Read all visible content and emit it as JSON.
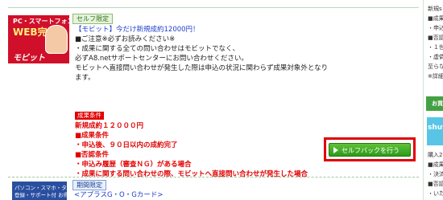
{
  "offer": {
    "thumbnail": {
      "line1": "PC・スマートフォンから",
      "line2": "WEB完結",
      "brand": "モビット"
    },
    "badge": "セルフ限定",
    "title": "【モビット】今だけ新規成約12000円！",
    "notice_heading": "■ご注意※必ずお読みください※",
    "notice_lines": [
      "・成果に関する全ての問い合わせはモビットでなく、",
      "必ずA8.netサポートセンターにお問い合わせください。",
      "モビットへ直接問い合わせが発生した際は申込の状況に関わらず成果対象外となり",
      "ます。"
    ],
    "conditions_label": "成果条件",
    "reward": "新規成約１２０００円",
    "success_heading": "■成果条件",
    "success_item": "・申込後、９０日以内の成約完了",
    "reject_heading": "■否認条件",
    "reject_items": [
      "・申込み履歴（審査ＮＧ）がある場合",
      "・成果に関する問い合わせの際、モビットへ直接問い合わせが発生した場合"
    ],
    "cashback_button": "セルフバックを行う"
  },
  "next_offer": {
    "thumbnail": {
      "line1": "パソコン・スマホ・タブレット",
      "line2": "登録・サポート付 お得なカード"
    },
    "badge": "期間限定",
    "title": "<アプラスG・O・Gカード>"
  },
  "sidebar": {
    "lines": [
      "新規s",
      "■成果",
      "・申込",
      "■否認",
      "・１世",
      "・虚偽",
      "至らな",
      "※詳細"
    ],
    "panel_label": "お買",
    "image_label": "shut",
    "bottom_lines": [
      "購入20",
      "■成果",
      "・決済",
      "■否認",
      "・いた"
    ]
  }
}
